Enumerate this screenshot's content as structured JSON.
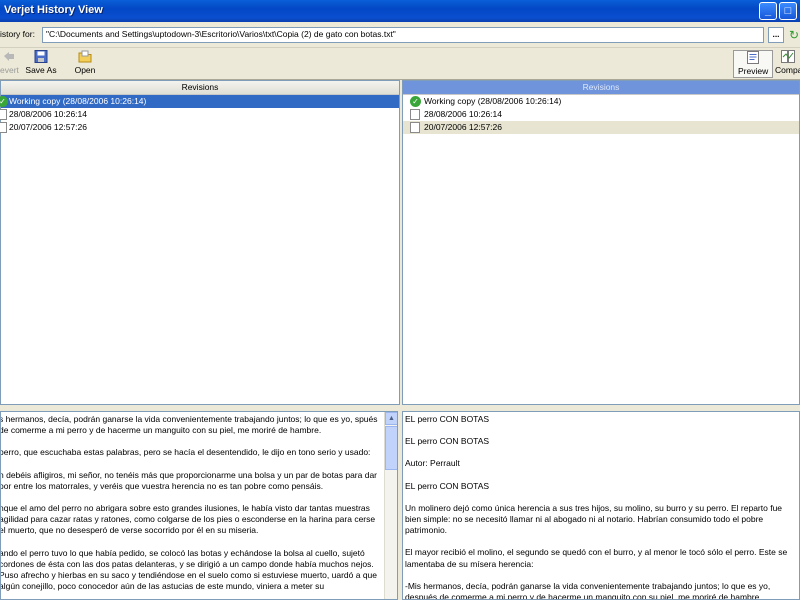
{
  "window": {
    "title": "Verjet History View"
  },
  "pathbar": {
    "label": "istory for:",
    "path": "\"C:\\Documents and Settings\\uptodown-3\\Escritorio\\Varios\\txt\\Copia (2) de gato con botas.txt\"",
    "browse_label": "..."
  },
  "toolbar": {
    "revert_label": "evert",
    "saveas_label": "Save As",
    "open_label": "Open",
    "preview_label": "Preview",
    "compare_label": "Compa"
  },
  "revisions": {
    "header": "Revisions",
    "left_items": [
      "Working copy (28/08/2006 10:26:14)",
      "28/08/2006 10:26:14",
      "20/07/2006 12:57:26"
    ],
    "right_items": [
      "Working copy (28/08/2006 10:26:14)",
      "28/08/2006 10:26:14",
      "20/07/2006 12:57:26"
    ]
  },
  "left_text": [
    "s hermanos, decía, podrán ganarse la vida convenientemente trabajando juntos; lo que es yo, spués de comerme a mi perro y de hacerme un manguito con su piel, me moriré de hambre.",
    "perro, que escuchaba estas palabras, pero se hacía el desentendido, le dijo en tono serio y usado:",
    "n debéis afligiros, mi señor, no tenéis más que proporcionarme una bolsa y un par de botas para dar por entre los matorrales, y veréis que vuestra herencia no es tan pobre como pensáis.",
    "nque el amo del perro no abrigara sobre esto grandes ilusiones, le había visto dar tantas muestras agilidad para cazar ratas y ratones, como colgarse de los pies o esconderse en la harina para cerse el muerto, que no desesperó de verse socorrido por él en su miseria.",
    "ando el perro tuvo lo que había pedido, se colocó las botas y echándose la bolsa al cuello, sujetó cordones de ésta con las dos patas delanteras, y se dirigió a un campo donde había muchos nejos. Puso afrecho y hierbas en su saco y tendiéndose en el suelo como si estuviese muerto, uardó a que algún conejillo, poco conocedor aún de las astucias de este mundo, viniera a meter su"
  ],
  "right_text": [
    "EL perro CON BOTAS",
    "EL perro CON BOTAS",
    "Autor: Perrault",
    "EL perro CON BOTAS",
    "Un molinero dejó como única herencia a sus tres hijos, su molino, su burro y su perro. El reparto fue bien simple: no se necesitó llamar ni al abogado ni al notario. Habrían consumido todo el pobre patrimonio.",
    "El mayor recibió el molino, el segundo se quedó con el burro, y al menor le tocó sólo el perro. Este se lamentaba de su mísera herencia:",
    "-Mis hermanos, decía, podrán ganarse la vida convenientemente trabajando juntos; lo que es yo, después de comerme a mi perro y de hacerme un manguito con su piel, me moriré de hambre."
  ],
  "colors": {
    "titlebar": "#0a4fd0",
    "selection": "#316ac5",
    "right_header": "#6f94dc"
  }
}
